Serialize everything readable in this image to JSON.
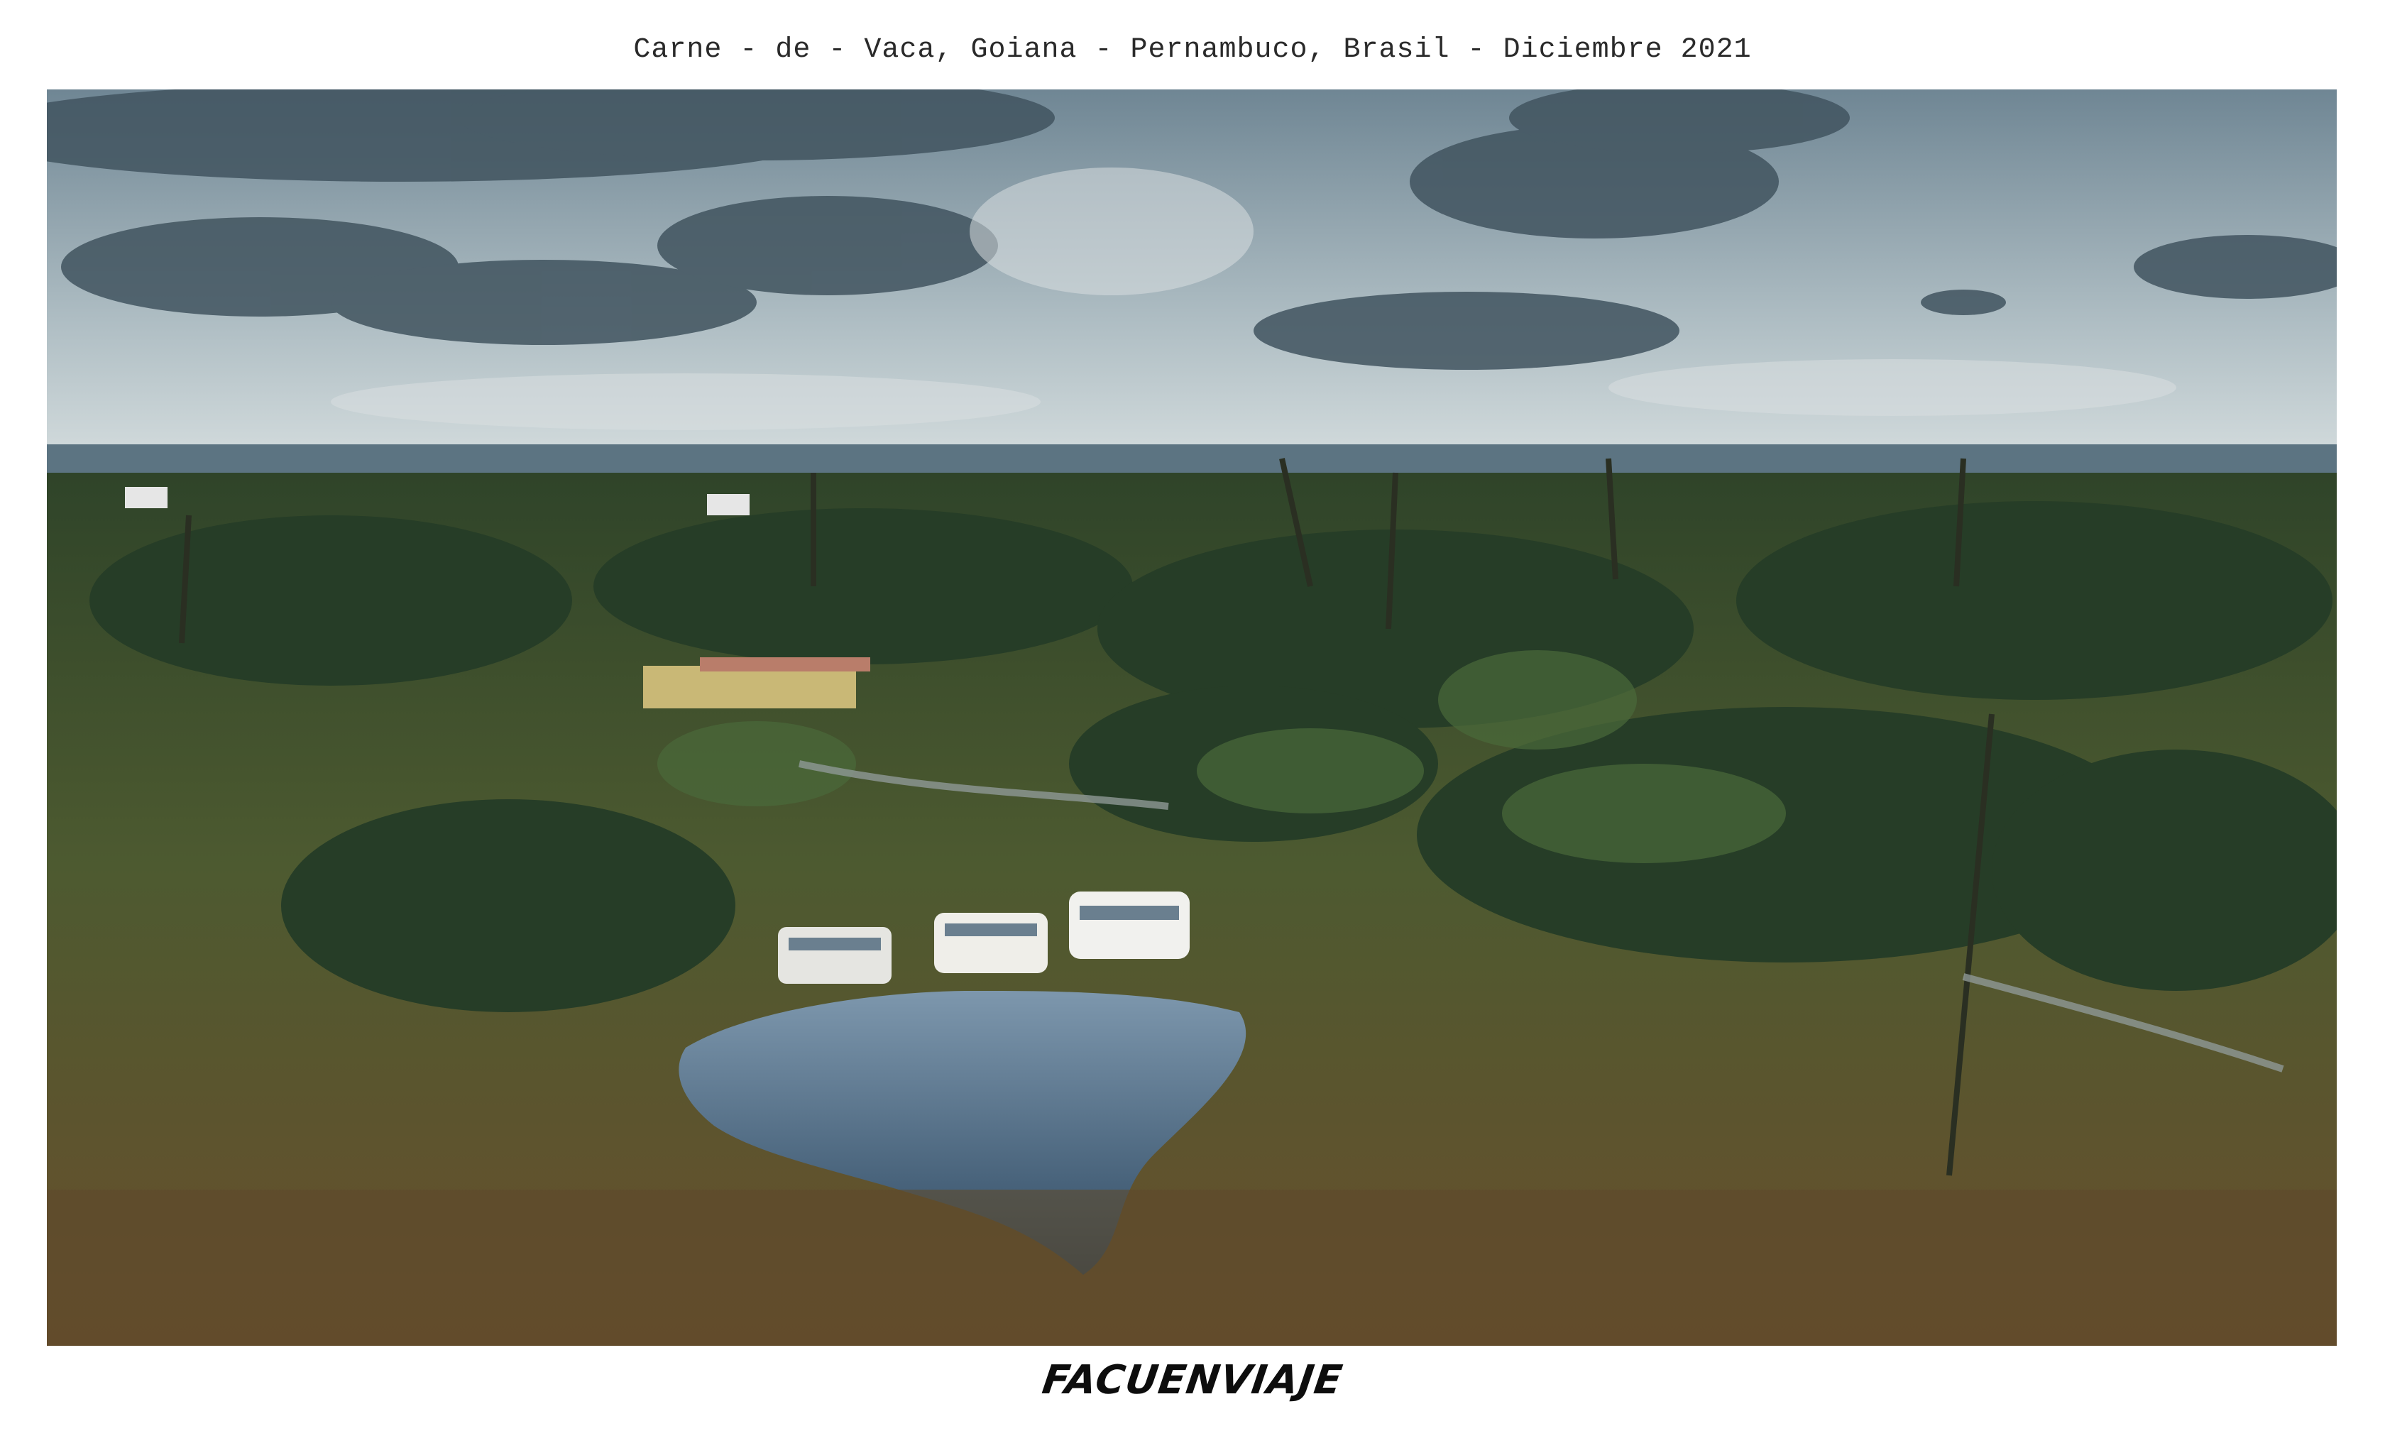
{
  "caption": "Carne - de - Vaca, Goiana - Pernambuco, Brasil - Diciembre 2021",
  "brand": "FACUENVIAJE",
  "photo": {
    "subject": "aerial-landscape",
    "colors": {
      "sky_top": "#6f8694",
      "sky_bottom": "#c9d4d6",
      "cloud": "#3f5260",
      "ocean": "#5c7482",
      "vegetation_dark": "#243a28",
      "vegetation_mid": "#3e5a32",
      "grass": "#6b5a33",
      "pond": "#3a5670",
      "van": "#e9e9e6"
    }
  }
}
